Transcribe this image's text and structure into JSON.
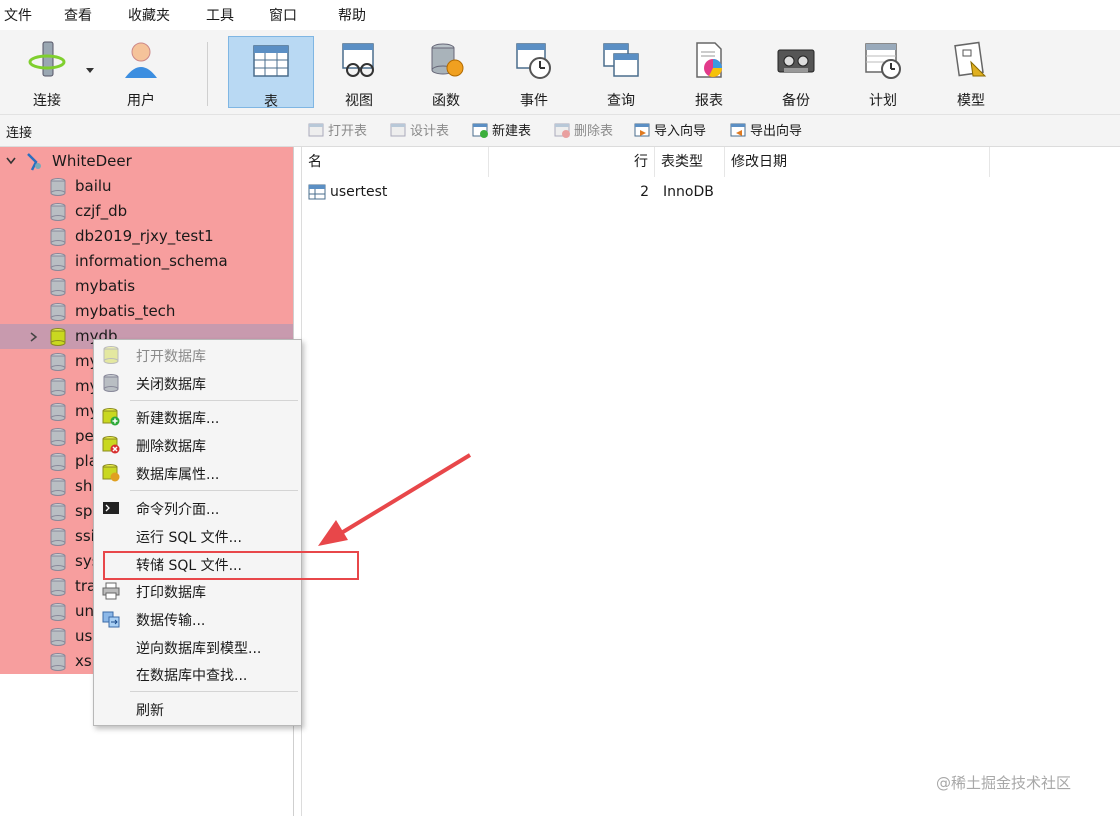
{
  "menu": [
    "文件",
    "查看",
    "收藏夹",
    "工具",
    "窗口",
    "帮助"
  ],
  "toolbar": {
    "connect": "连接",
    "user": "用户",
    "table": "表",
    "view": "视图",
    "function": "函数",
    "event": "事件",
    "query": "查询",
    "report": "报表",
    "backup": "备份",
    "schedule": "计划",
    "model": "模型"
  },
  "subbar": {
    "connection_label": "连接",
    "open_table": "打开表",
    "design_table": "设计表",
    "new_table": "新建表",
    "delete_table": "删除表",
    "import_wizard": "导入向导",
    "export_wizard": "导出向导"
  },
  "tree": {
    "root": "WhiteDeer",
    "items": [
      "bailu",
      "czjf_db",
      "db2019_rjxy_test1",
      "information_schema",
      "mybatis",
      "mybatis_tech",
      "mydb",
      "my",
      "my",
      "my",
      "pe",
      "pla",
      "sh",
      "sp",
      "ssi",
      "sys",
      "tra",
      "un",
      "us",
      "xsl"
    ]
  },
  "table": {
    "headers": {
      "name": "名",
      "rows": "行",
      "type": "表类型",
      "modified": "修改日期"
    },
    "rows": [
      {
        "name": "usertest",
        "rows": "2",
        "type": "InnoDB",
        "modified": ""
      }
    ]
  },
  "context_menu": {
    "open_db": "打开数据库",
    "close_db": "关闭数据库",
    "new_db": "新建数据库...",
    "delete_db": "删除数据库",
    "db_props": "数据库属性...",
    "cmd": "命令列介面...",
    "run_sql": "运行 SQL 文件...",
    "dump_sql": "转储 SQL 文件...",
    "print_db": "打印数据库",
    "transfer": "数据传输...",
    "reverse": "逆向数据库到模型...",
    "find": "在数据库中查找...",
    "refresh": "刷新"
  },
  "watermark": "@稀土掘金技术社区",
  "colors": {
    "highlight": "#f79e9e",
    "selected": "#c89aae",
    "annotation": "#e8474a",
    "active_tool": "#b9d9f3"
  }
}
